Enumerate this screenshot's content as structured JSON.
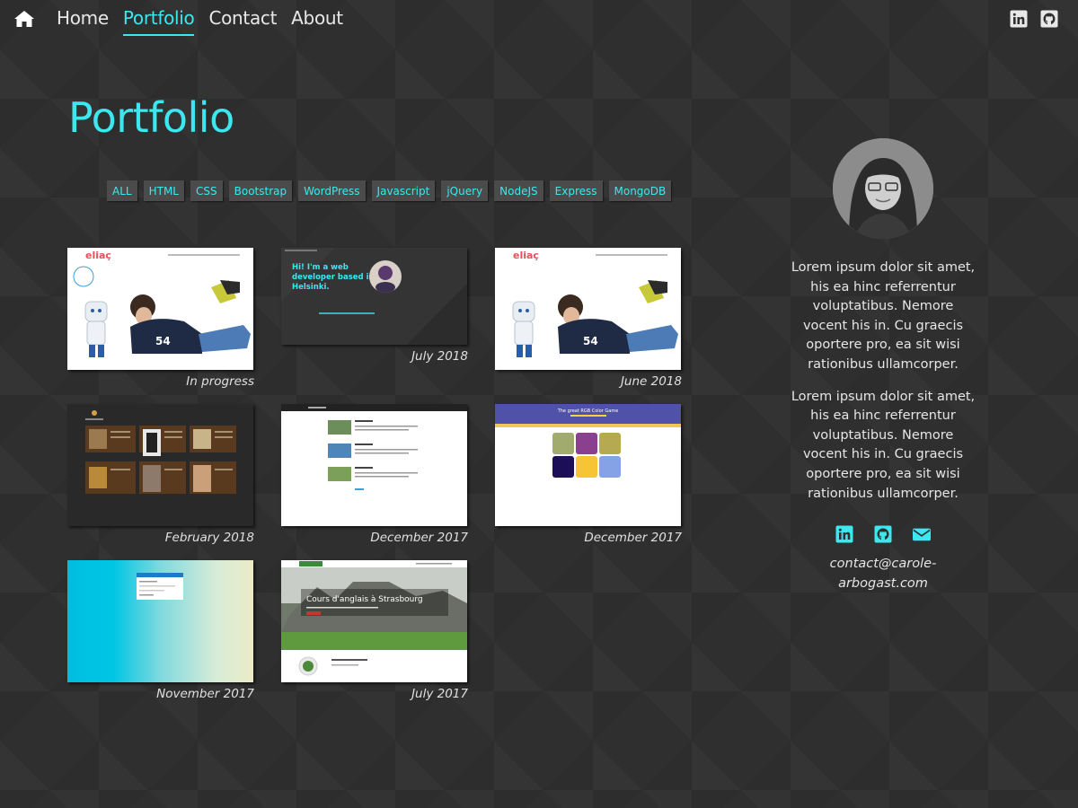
{
  "nav": {
    "home_icon": "home-icon",
    "links": [
      "Home",
      "Portfolio",
      "Contact",
      "About"
    ],
    "active": "Portfolio",
    "social_icons": [
      "linkedin-icon",
      "github-icon"
    ]
  },
  "page": {
    "title": "Portfolio"
  },
  "filters": [
    "ALL",
    "HTML",
    "CSS",
    "Bootstrap",
    "WordPress",
    "Javascript",
    "jQuery",
    "NodeJS",
    "Express",
    "MongoDB"
  ],
  "projects": [
    {
      "date": "In progress",
      "thumb_logo": "eliaç"
    },
    {
      "date": "July 2018",
      "thumb_text": "Hi! I'm a web developer based in Helsinki."
    },
    {
      "date": "June 2018",
      "thumb_logo": "eliaç"
    },
    {
      "date": "February 2018"
    },
    {
      "date": "December 2017"
    },
    {
      "date": "December 2017",
      "thumb_title": "The great RGB Color Game"
    },
    {
      "date": "November 2017"
    },
    {
      "date": "July 2017",
      "thumb_title": "Cours d'anglais à Strasbourg"
    }
  ],
  "sidebar": {
    "bio": [
      "Lorem ipsum dolor sit amet, his ea hinc referrentur voluptatibus. Nemore vocent his in. Cu graecis oportere pro, ea sit wisi rationibus ullamcorper.",
      "Lorem ipsum dolor sit amet, his ea hinc referrentur voluptatibus. Nemore vocent his in. Cu graecis oportere pro, ea sit wisi rationibus ullamcorper."
    ],
    "social_icons": [
      "linkedin-icon",
      "github-icon",
      "envelope-icon"
    ],
    "email": "contact@carole-arbogast.com"
  },
  "colors": {
    "accent": "#3ce7ef",
    "background": "#2f2f2f",
    "button_bg": "#4b4b4b"
  }
}
